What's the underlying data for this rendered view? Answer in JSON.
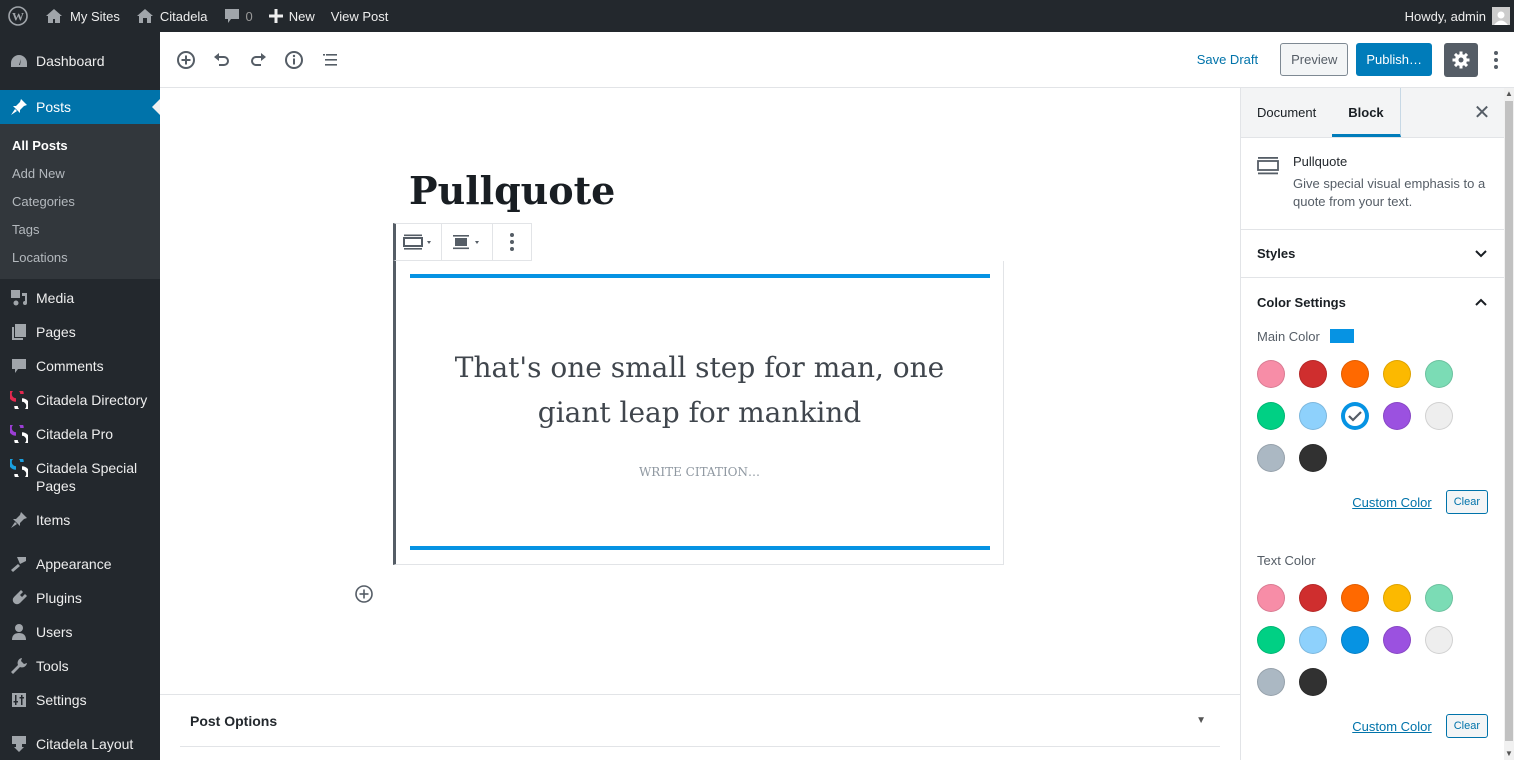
{
  "adminbar": {
    "my_sites": "My Sites",
    "site_name": "Citadela",
    "comments_count": "0",
    "new_label": "New",
    "view_post": "View Post",
    "howdy": "Howdy, admin"
  },
  "sidebar": {
    "dashboard": "Dashboard",
    "posts": "Posts",
    "posts_submenu": [
      "All Posts",
      "Add New",
      "Categories",
      "Tags",
      "Locations"
    ],
    "media": "Media",
    "pages": "Pages",
    "comments": "Comments",
    "citadela_directory": "Citadela Directory",
    "citadela_pro": "Citadela Pro",
    "citadela_special_pages": "Citadela Special Pages",
    "items": "Items",
    "appearance": "Appearance",
    "plugins": "Plugins",
    "users": "Users",
    "tools": "Tools",
    "settings": "Settings",
    "citadela_layout": "Citadela Layout",
    "brand_colors": {
      "directory": "#e3284f",
      "pro": "#9b3ed5",
      "special": "#1aa0e0"
    }
  },
  "toolbar": {
    "save_draft": "Save Draft",
    "preview": "Preview",
    "publish": "Publish…"
  },
  "editor": {
    "post_title": "Pullquote",
    "quote_text": "That's one small step for man, one giant leap for mankind",
    "citation_placeholder": "Write citation…",
    "post_options": "Post Options",
    "accent_color": "#0693e3"
  },
  "panel": {
    "tab_document": "Document",
    "tab_block": "Block",
    "block_name": "Pullquote",
    "block_description": "Give special visual emphasis to a quote from your text.",
    "styles_label": "Styles",
    "color_settings_label": "Color Settings",
    "main_color_label": "Main Color",
    "main_color_value": "#0693e3",
    "text_color_label": "Text Color",
    "custom_color": "Custom Color",
    "clear": "Clear",
    "palette": [
      "#f78da7",
      "#cf2e2e",
      "#ff6900",
      "#fcb900",
      "#7bdcb5",
      "#00d084",
      "#8ed1fc",
      "#0693e3",
      "#9b51e0",
      "#eeeeee",
      "#abb8c3",
      "#313131"
    ],
    "main_selected_index": 7
  }
}
